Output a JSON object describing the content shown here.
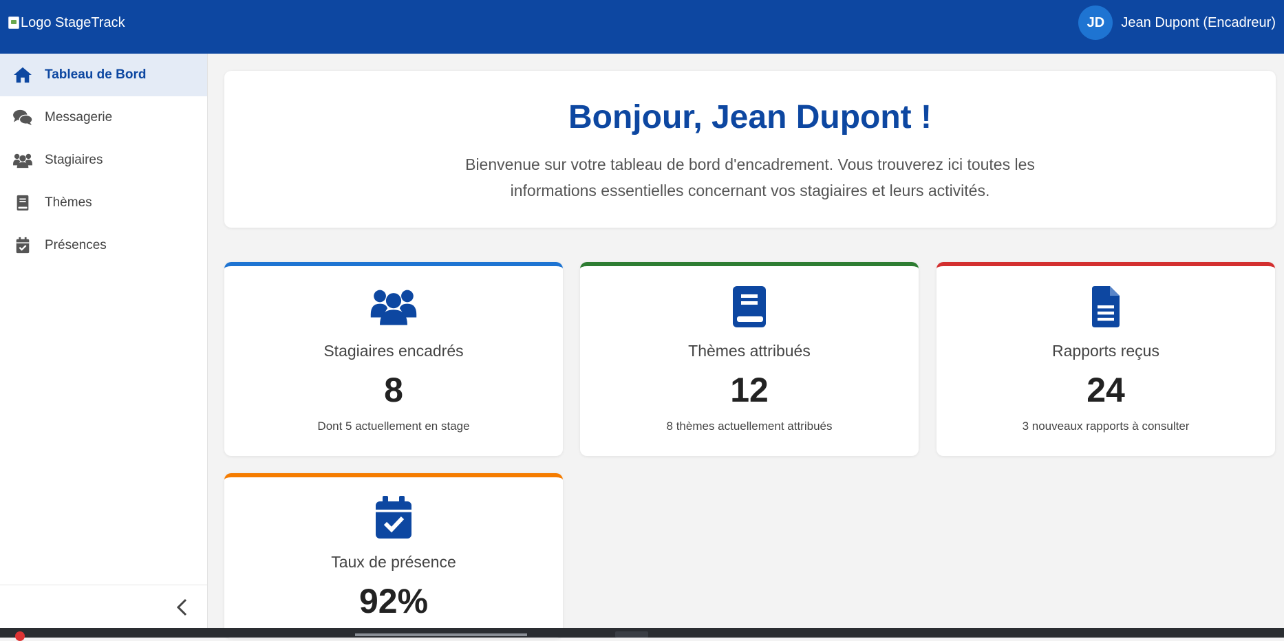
{
  "header": {
    "logo_alt": "Logo StageTrack",
    "user_initials": "JD",
    "user_name": "Jean Dupont (Encadreur)"
  },
  "sidebar": {
    "items": [
      {
        "label": "Tableau de Bord",
        "icon": "home-icon",
        "active": true
      },
      {
        "label": "Messagerie",
        "icon": "chat-icon",
        "active": false
      },
      {
        "label": "Stagiaires",
        "icon": "users-icon",
        "active": false
      },
      {
        "label": "Thèmes",
        "icon": "book-icon",
        "active": false
      },
      {
        "label": "Présences",
        "icon": "calendar-check-icon",
        "active": false
      }
    ],
    "collapse_icon": "chevron-left-icon"
  },
  "welcome": {
    "title": "Bonjour, Jean Dupont !",
    "text": "Bienvenue sur votre tableau de bord d'encadrement. Vous trouverez ici toutes les informations essentielles concernant vos stagiaires et leurs activités."
  },
  "cards": [
    {
      "title": "Stagiaires encadrés",
      "value": "8",
      "sub": "Dont 5 actuellement en stage",
      "icon": "users-icon",
      "accent": "#1e74d2"
    },
    {
      "title": "Thèmes attribués",
      "value": "12",
      "sub": "8 thèmes actuellement attribués",
      "icon": "book-icon",
      "accent": "#2e7d32"
    },
    {
      "title": "Rapports reçus",
      "value": "24",
      "sub": "3 nouveaux rapports à consulter",
      "icon": "file-icon",
      "accent": "#d32f2f"
    },
    {
      "title": "Taux de présence",
      "value": "92%",
      "sub": "",
      "icon": "calendar-check-icon",
      "accent": "#f57c00"
    }
  ],
  "colors": {
    "primary": "#0d47a1",
    "avatar": "#1e74d2",
    "background": "#f3f3f3"
  }
}
